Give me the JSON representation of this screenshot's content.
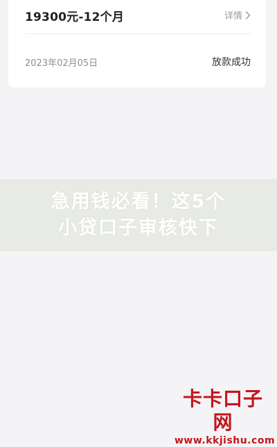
{
  "loan_card": {
    "amount_term": "19300元-12个月",
    "detail_label": "详情",
    "date": "2023年02月05日",
    "status": "放款成功"
  },
  "banner": {
    "line1": "急用钱必看！这5个",
    "line2": "小贷口子审核快下"
  },
  "watermark": {
    "logo_text": "卡卡口子网",
    "url": "www.kkjishu.com",
    "color": "#c4161c"
  },
  "icons": {
    "detail_chevron": "chevron-right-icon"
  }
}
